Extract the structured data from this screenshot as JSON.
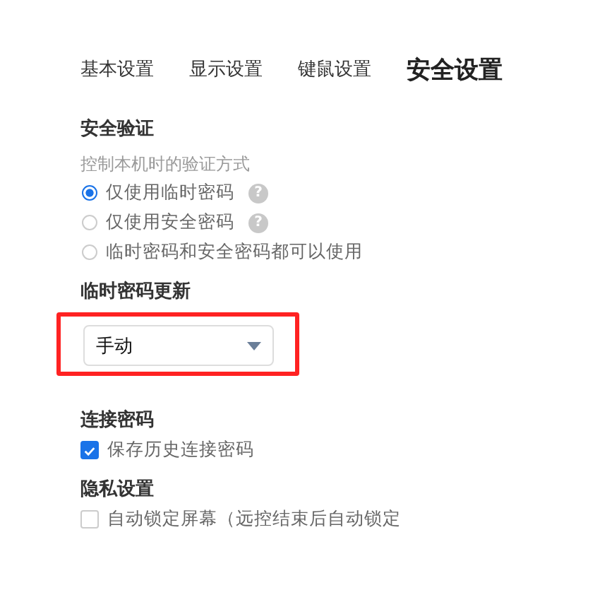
{
  "tabs": [
    {
      "label": "基本设置",
      "selected": false
    },
    {
      "label": "显示设置",
      "selected": false
    },
    {
      "label": "键鼠设置",
      "selected": false
    },
    {
      "label": "安全设置",
      "selected": true
    }
  ],
  "sections": [
    {
      "title": "安全验证",
      "description": "控制本机时的验证方式",
      "options": [
        {
          "kind": "radio",
          "label": "仅使用临时密码",
          "selected": true,
          "help": "?"
        },
        {
          "kind": "radio",
          "label": "仅使用安全密码",
          "selected": false,
          "help": "?"
        },
        {
          "kind": "radio",
          "label": "临时密码和安全密码都可以使用",
          "selected": false
        }
      ]
    },
    {
      "title": "临时密码更新",
      "options": [
        {
          "kind": "dropdown",
          "value": "手动",
          "highlighted": true
        }
      ]
    },
    {
      "title": "连接密码",
      "options": [
        {
          "kind": "checkbox",
          "label": "保存历史连接密码",
          "checked": true
        }
      ]
    },
    {
      "title": "隐私设置",
      "options": [
        {
          "kind": "checkbox",
          "label": "自动锁定屏幕（远控结束后自动锁定",
          "checked": false
        }
      ]
    }
  ]
}
